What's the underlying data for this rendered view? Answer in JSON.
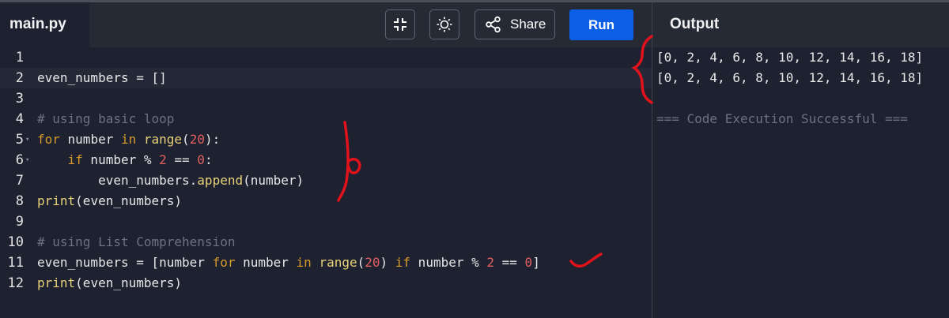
{
  "toolbar": {
    "file_tab": "main.py",
    "share_label": "Share",
    "run_label": "Run",
    "icons": [
      "collapse-icon",
      "theme-icon",
      "share-icon"
    ]
  },
  "output": {
    "title": "Output",
    "lines": [
      "[0, 2, 4, 6, 8, 10, 12, 14, 16, 18]",
      "[0, 2, 4, 6, 8, 10, 12, 14, 16, 18]",
      "",
      "=== Code Execution Successful ==="
    ]
  },
  "editor": {
    "active_line": 2,
    "lines": [
      {
        "n": "1",
        "tokens": []
      },
      {
        "n": "2",
        "tokens": [
          [
            "op",
            "even_numbers = []"
          ]
        ]
      },
      {
        "n": "3",
        "tokens": []
      },
      {
        "n": "4",
        "tokens": [
          [
            "cm",
            "# using basic loop"
          ]
        ]
      },
      {
        "n": "5",
        "fold": true,
        "tokens": [
          [
            "kw",
            "for"
          ],
          [
            "op",
            " number "
          ],
          [
            "kw",
            "in"
          ],
          [
            "op",
            " "
          ],
          [
            "fn",
            "range"
          ],
          [
            "op",
            "("
          ],
          [
            "num",
            "20"
          ],
          [
            "op",
            "):"
          ]
        ]
      },
      {
        "n": "6",
        "fold": true,
        "tokens": [
          [
            "op",
            "    "
          ],
          [
            "kw",
            "if"
          ],
          [
            "op",
            " number % "
          ],
          [
            "num",
            "2"
          ],
          [
            "op",
            " == "
          ],
          [
            "num",
            "0"
          ],
          [
            "op",
            ":"
          ]
        ]
      },
      {
        "n": "7",
        "tokens": [
          [
            "op",
            "        even_numbers."
          ],
          [
            "fn",
            "append"
          ],
          [
            "op",
            "(number)"
          ]
        ]
      },
      {
        "n": "8",
        "tokens": [
          [
            "fn",
            "print"
          ],
          [
            "op",
            "(even_numbers)"
          ]
        ]
      },
      {
        "n": "9",
        "tokens": []
      },
      {
        "n": "10",
        "tokens": [
          [
            "cm",
            "# using List Comprehension"
          ]
        ]
      },
      {
        "n": "11",
        "tokens": [
          [
            "op",
            "even_numbers = [number "
          ],
          [
            "kw",
            "for"
          ],
          [
            "op",
            " number "
          ],
          [
            "kw",
            "in"
          ],
          [
            "op",
            " "
          ],
          [
            "fn",
            "range"
          ],
          [
            "op",
            "("
          ],
          [
            "num",
            "20"
          ],
          [
            "op",
            ") "
          ],
          [
            "kw",
            "if"
          ],
          [
            "op",
            " number % "
          ],
          [
            "num",
            "2"
          ],
          [
            "op",
            " == "
          ],
          [
            "num",
            "0"
          ],
          [
            "op",
            "]"
          ]
        ]
      },
      {
        "n": "12",
        "tokens": [
          [
            "fn",
            "print"
          ],
          [
            "op",
            "(even_numbers)"
          ]
        ]
      }
    ]
  },
  "annotations": {
    "color": "#e0121b",
    "handwritten_text": "6"
  },
  "colors": {
    "run_button": "#0b5ee6",
    "keyword": "#d79a2a",
    "number": "#e06060",
    "function": "#e8d27a",
    "comment": "#6c7282"
  }
}
